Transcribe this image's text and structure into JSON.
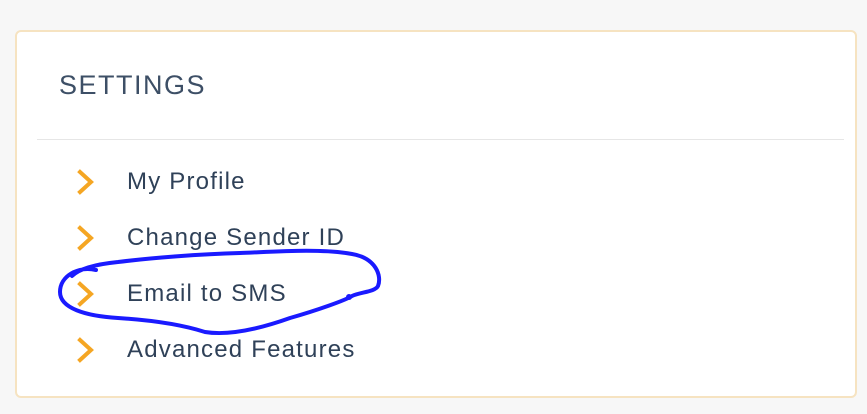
{
  "settings_panel": {
    "title": "SETTINGS",
    "items": [
      {
        "label": "My Profile",
        "icon": "chevron-right-icon"
      },
      {
        "label": "Change Sender ID",
        "icon": "chevron-right-icon"
      },
      {
        "label": "Email to SMS",
        "icon": "chevron-right-icon"
      },
      {
        "label": "Advanced Features",
        "icon": "chevron-right-icon"
      }
    ]
  },
  "colors": {
    "accent_chevron": "#f5a623",
    "title_text": "#3d4f66",
    "item_text": "#2f4158",
    "panel_border": "#f6e3c1",
    "annotation_ink": "#1a1aff"
  },
  "annotation": {
    "type": "hand-drawn circle",
    "highlights_item": "Email to SMS"
  }
}
